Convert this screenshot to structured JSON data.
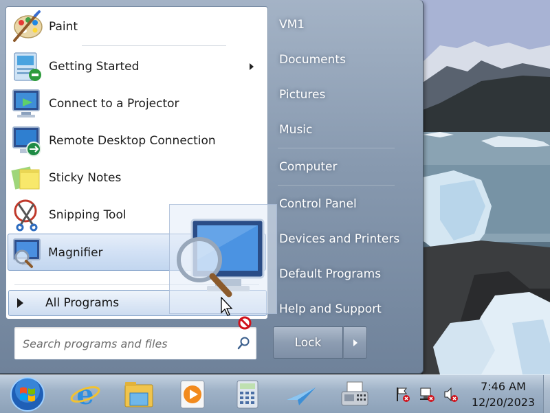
{
  "programs": [
    {
      "label": "Paint",
      "icon": "paint-icon",
      "submenu": false
    },
    {
      "label": "Getting Started",
      "icon": "getting-started-icon",
      "submenu": true
    },
    {
      "label": "Connect to a Projector",
      "icon": "projector-icon",
      "submenu": false
    },
    {
      "label": "Remote Desktop Connection",
      "icon": "remote-desktop-icon",
      "submenu": false
    },
    {
      "label": "Sticky Notes",
      "icon": "sticky-notes-icon",
      "submenu": false
    },
    {
      "label": "Snipping Tool",
      "icon": "snipping-tool-icon",
      "submenu": false
    },
    {
      "label": "Magnifier",
      "icon": "magnifier-icon",
      "submenu": false,
      "highlighted": true
    }
  ],
  "all_programs": {
    "label": "All Programs"
  },
  "search": {
    "placeholder": "Search programs and files"
  },
  "right_pane": {
    "items": [
      {
        "label": "VM1"
      },
      {
        "label": "Documents"
      },
      {
        "label": "Pictures"
      },
      {
        "label": "Music"
      },
      {
        "label": "Computer"
      },
      {
        "label": "Control Panel"
      },
      {
        "label": "Devices and Printers"
      },
      {
        "label": "Default Programs"
      },
      {
        "label": "Help and Support"
      }
    ]
  },
  "power": {
    "lock_label": "Lock"
  },
  "taskbar": {
    "pinned": [
      "internet-explorer-icon",
      "windows-explorer-icon",
      "media-player-icon",
      "calculator-icon",
      "paper-plane-icon",
      "fax-scan-icon"
    ],
    "tray": [
      "action-center-flag-icon",
      "network-icon",
      "volume-muted-icon"
    ]
  },
  "clock": {
    "time": "7:46 AM",
    "date": "12/20/2023"
  },
  "colors": {
    "accent": "#1f5fb6",
    "menu_frame": "#8799af",
    "taskbar": "#9fb2c7"
  }
}
